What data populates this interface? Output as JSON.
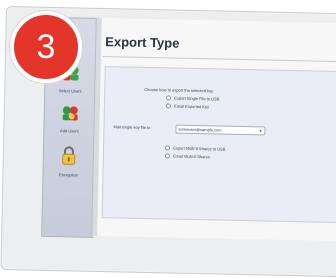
{
  "step_badge": "3",
  "window": {
    "title": "Export Type"
  },
  "sidebar": {
    "items": [
      {
        "label": "Select Users",
        "icon": "users-icon"
      },
      {
        "label": "Add Users",
        "icon": "add-user-icon"
      },
      {
        "label": "Encryption",
        "icon": "padlock-icon"
      }
    ]
  },
  "export": {
    "prompt": "Choose how to export the selected key:",
    "options_group1": [
      "Export Single File to USB",
      "Email Exported Key"
    ],
    "select_label": "Mail single key file to:",
    "select_value": "someuser@sample.com",
    "options_group2": [
      "Export Multi-It Shares to USB",
      "Email Multi-It Shares"
    ]
  },
  "colors": {
    "badge": "#e4352b",
    "title": "#2a3344",
    "panel": "#e9edf5"
  }
}
